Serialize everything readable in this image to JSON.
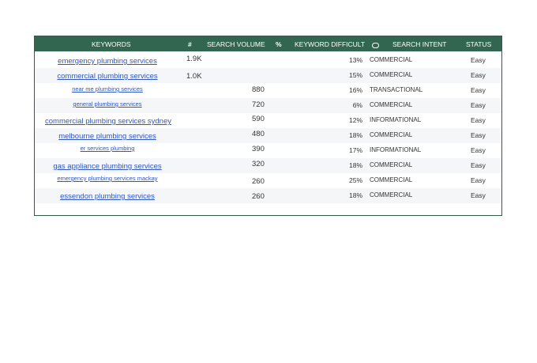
{
  "header": {
    "keywords": "KEYWORDS",
    "hash": "#",
    "search_volume": "SEARCH VOLUME",
    "percent": "%",
    "keyword_difficulty": "KEYWORD DIFFICULT",
    "intent_icon": "circle-icon",
    "search_intent": "SEARCH INTENT",
    "status": "STATUS"
  },
  "rows": [
    {
      "keyword": "emergency plumbing services",
      "volume": "1.9K",
      "kd": "13%",
      "intent": "COMMERCIAL",
      "status": "Easy"
    },
    {
      "keyword": "commercial plumbing services",
      "volume": "1.0K",
      "kd": "15%",
      "intent": "COMMERCIAL",
      "status": "Easy"
    },
    {
      "keyword": "near me plumbing services",
      "volume": "880",
      "kd": "16%",
      "intent": "TRANSACTIONAL",
      "status": "Easy"
    },
    {
      "keyword": "general plumbing services",
      "volume": "720",
      "kd": "6%",
      "intent": "COMMERCIAL",
      "status": "Easy"
    },
    {
      "keyword": "commercial plumbing services sydney",
      "volume": "590",
      "kd": "12%",
      "intent": "INFORMATIONAL",
      "status": "Easy"
    },
    {
      "keyword": "melbourne plumbing services",
      "volume": "480",
      "kd": "18%",
      "intent": "COMMERCIAL",
      "status": "Easy"
    },
    {
      "keyword": "er services plumbing",
      "volume": "390",
      "kd": "17%",
      "intent": "INFORMATIONAL",
      "status": "Easy"
    },
    {
      "keyword": "gas appliance plumbing services",
      "volume": "320",
      "kd": "18%",
      "intent": "COMMERCIAL",
      "status": "Easy"
    },
    {
      "keyword": "emergency plumbing services mackay",
      "volume": "260",
      "kd": "25%",
      "intent": "COMMERCIAL",
      "status": "Easy"
    },
    {
      "keyword": "essendon plumbing services",
      "volume": "260",
      "kd": "18%",
      "intent": "COMMERCIAL",
      "status": "Easy"
    }
  ]
}
